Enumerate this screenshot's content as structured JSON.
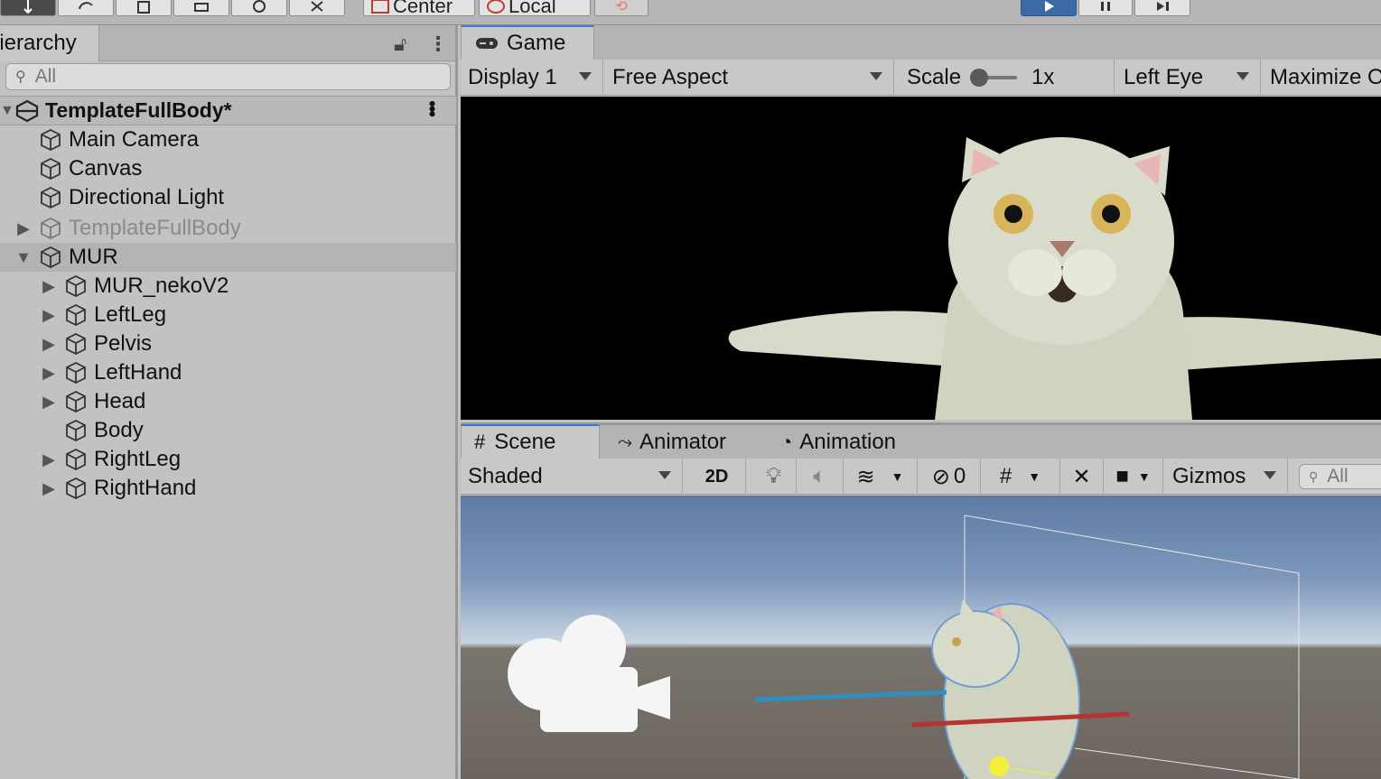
{
  "hierarchy": {
    "tab_label": "Hierarchy",
    "search_placeholder": "All",
    "scene_root": "TemplateFullBody*",
    "items": [
      {
        "label": "Main Camera",
        "expand": false
      },
      {
        "label": "Canvas",
        "expand": false
      },
      {
        "label": "Directional Light",
        "expand": false
      },
      {
        "label": "TemplateFullBody",
        "expand": true,
        "faded": true
      },
      {
        "label": "MUR",
        "expand": true,
        "expanded": true,
        "selected": true
      },
      {
        "label": "MUR_nekoV2",
        "expand": true,
        "child": true
      },
      {
        "label": "LeftLeg",
        "expand": true,
        "child": true
      },
      {
        "label": "Pelvis",
        "expand": true,
        "child": true
      },
      {
        "label": "LeftHand",
        "expand": true,
        "child": true
      },
      {
        "label": "Head",
        "expand": true,
        "child": true
      },
      {
        "label": "Body",
        "expand": false,
        "child": true
      },
      {
        "label": "RightLeg",
        "expand": true,
        "child": true
      },
      {
        "label": "RightHand",
        "expand": true,
        "child": true
      }
    ]
  },
  "toolbar": {
    "pivot_label": "Center",
    "space_label": "Local",
    "icons": [
      "move-tool-icon",
      "rotate-tool-icon",
      "scale-tool-icon",
      "rect-tool-icon",
      "transform-tool-icon",
      "custom-tool-icon",
      "snap-icon",
      "play-icon",
      "pause-icon",
      "step-icon"
    ]
  },
  "game": {
    "tab_label": "Game",
    "display": "Display 1",
    "aspect": "Free Aspect",
    "scale_label": "Scale",
    "scale_value": "1x",
    "eye": "Left Eye",
    "maximize": "Maximize On Play"
  },
  "scene": {
    "tabs": [
      "Scene",
      "Animator",
      "Animation"
    ],
    "shading": "Shaded",
    "mode_2d": "2D",
    "hidden_count": "0",
    "gizmos": "Gizmos",
    "search_placeholder": "All"
  },
  "colors": {
    "accent": "#3a79d6",
    "play": "#3b6aa5",
    "panel": "#c2c2c2"
  }
}
